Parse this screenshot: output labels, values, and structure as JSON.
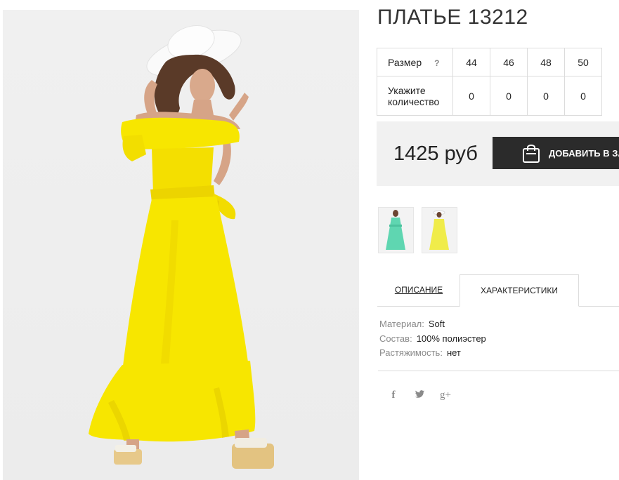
{
  "product": {
    "title": "ПЛАТЬЕ 13212",
    "price": "1425 руб",
    "add_to_cart_label": "ДОБАВИТЬ В ЗАКАЗ"
  },
  "size_table": {
    "size_label": "Размер",
    "help_mark": "?",
    "qty_label_line1": "Укажите",
    "qty_label_line2": "количество",
    "sizes": [
      "44",
      "46",
      "48",
      "50"
    ],
    "quantities": [
      "0",
      "0",
      "0",
      "0"
    ]
  },
  "thumbnails": [
    {
      "dress_color": "#5fd6b1"
    },
    {
      "dress_color": "#f0ec4a"
    }
  ],
  "tabs": {
    "description": "ОПИСАНИЕ",
    "characteristics": "ХАРАКТЕРИСТИКИ",
    "active": "characteristics"
  },
  "specs": [
    {
      "key": "Материал:",
      "value": "Soft"
    },
    {
      "key": "Состав:",
      "value": "100% полиэстер"
    },
    {
      "key": "Растяжимость:",
      "value": "нет"
    }
  ],
  "social": {
    "facebook": "f",
    "twitter": "twitter-icon",
    "google_plus": "g+"
  },
  "colors": {
    "dress": "#f7e600",
    "button": "#2b2b2b",
    "buybox_bg": "#f1f1f1"
  }
}
